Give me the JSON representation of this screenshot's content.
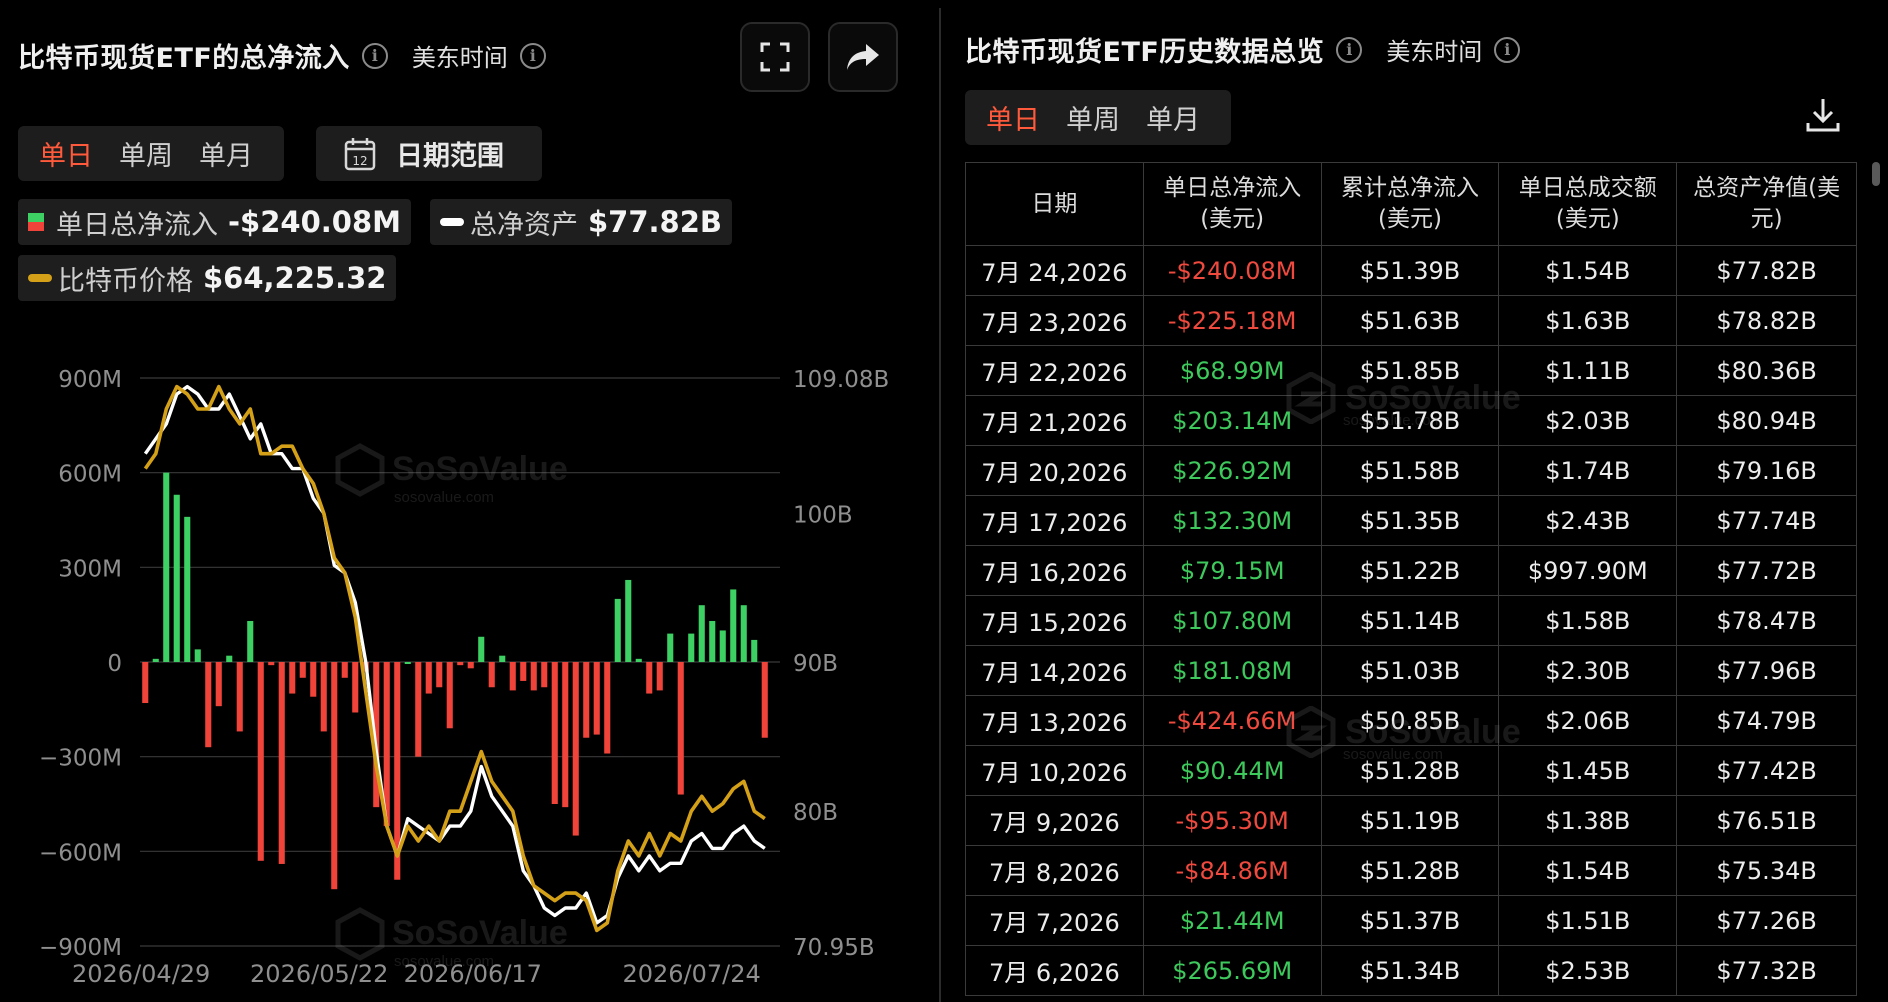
{
  "left": {
    "title": "比特币现货ETF的总净流入",
    "timezone": "美东时间",
    "tabs": [
      "单日",
      "单周",
      "单月"
    ],
    "active_tab": "单日",
    "date_range_label": "日期范围",
    "calendar_day": "12",
    "legend": {
      "net_inflow_name": "单日总净流入",
      "net_inflow_value": "-$240.08M",
      "net_assets_name": "总净资产",
      "net_assets_value": "$77.82B",
      "btc_price_name": "比特币价格",
      "btc_price_value": "$64,225.32"
    },
    "watermark": "SoSoValue",
    "watermark_sub": "sosovalue.com"
  },
  "chart_data": {
    "type": "bar",
    "title": "比特币现货ETF的总净流入",
    "x_ticks": [
      "2026/04/29",
      "2026/05/22",
      "2026/06/17",
      "2026/07/24"
    ],
    "y_left_ticks": [
      "900M",
      "600M",
      "300M",
      "0",
      "−300M",
      "−600M",
      "−900M"
    ],
    "y_left_range": [
      -900,
      900
    ],
    "y_right_ticks": [
      "109.08B",
      "100B",
      "90B",
      "80B",
      "70.95B"
    ],
    "y_right_range": [
      70.95,
      109.08
    ],
    "series": [
      {
        "name": "单日总净流入",
        "unit": "M USD",
        "type": "bar",
        "values": [
          -130,
          10,
          600,
          530,
          460,
          40,
          -270,
          -140,
          20,
          -220,
          130,
          -630,
          -10,
          -640,
          -100,
          -50,
          -110,
          -220,
          -720,
          -50,
          -160,
          -30,
          -460,
          -520,
          -690,
          0,
          -300,
          -100,
          -80,
          -210,
          -10,
          -20,
          80,
          -80,
          20,
          -90,
          -60,
          -90,
          -80,
          -450,
          -460,
          -550,
          -240,
          -230,
          -290,
          200,
          260,
          10,
          -100,
          -90,
          90,
          -420,
          90,
          180,
          130,
          100,
          230,
          180,
          70,
          -240
        ]
      },
      {
        "name": "总净资产",
        "unit": "B USD",
        "type": "line",
        "color": "#ffffff",
        "values": [
          104,
          105,
          106,
          108,
          108.5,
          108,
          107,
          107,
          108,
          106.5,
          105,
          106,
          104,
          104,
          103,
          103,
          101,
          100,
          96.5,
          96,
          94,
          90,
          84,
          79,
          77,
          79.5,
          79,
          78.5,
          78,
          79,
          79,
          80,
          83,
          81,
          80,
          79,
          76,
          75,
          73.5,
          73,
          73.5,
          73.5,
          74.5,
          72.5,
          73,
          75.5,
          77,
          76,
          77,
          76,
          76.5,
          76.5,
          78,
          78.5,
          77.5,
          77.5,
          78.5,
          79,
          78,
          77.5
        ]
      },
      {
        "name": "比特币价格",
        "unit": "relative",
        "type": "line",
        "color": "#d4a017",
        "values": [
          103,
          104,
          107,
          108.5,
          108,
          107,
          107,
          108.5,
          107,
          106,
          107,
          104,
          104,
          104.5,
          104.5,
          103,
          102,
          100,
          97,
          96,
          93,
          88,
          83,
          79,
          77,
          79,
          78,
          79,
          78,
          80,
          80,
          82,
          84,
          82,
          81,
          80,
          77,
          75,
          74.5,
          74,
          74.5,
          74.5,
          74,
          72,
          72.5,
          76,
          78,
          77,
          78.5,
          77,
          78.5,
          78,
          80,
          81,
          80,
          80.5,
          81.5,
          82,
          80,
          79.5
        ]
      }
    ]
  },
  "right": {
    "title": "比特币现货ETF历史数据总览",
    "timezone": "美东时间",
    "tabs": [
      "单日",
      "单周",
      "单月"
    ],
    "active_tab": "单日",
    "headers": [
      "日期",
      "单日总净流入(美元)",
      "累计总净流入(美元)",
      "单日总成交额(美元)",
      "总资产净值(美元)"
    ],
    "header_lines": [
      [
        "日期"
      ],
      [
        "单日总净流入",
        "(美元)"
      ],
      [
        "累计总净流入",
        "(美元)"
      ],
      [
        "单日总成交额",
        "(美元)"
      ],
      [
        "总资产净值(美",
        "元)"
      ]
    ],
    "rows": [
      [
        "7月 24,2026",
        "-$240.08M",
        "$51.39B",
        "$1.54B",
        "$77.82B"
      ],
      [
        "7月 23,2026",
        "-$225.18M",
        "$51.63B",
        "$1.63B",
        "$78.82B"
      ],
      [
        "7月 22,2026",
        "$68.99M",
        "$51.85B",
        "$1.11B",
        "$80.36B"
      ],
      [
        "7月 21,2026",
        "$203.14M",
        "$51.78B",
        "$2.03B",
        "$80.94B"
      ],
      [
        "7月 20,2026",
        "$226.92M",
        "$51.58B",
        "$1.74B",
        "$79.16B"
      ],
      [
        "7月 17,2026",
        "$132.30M",
        "$51.35B",
        "$2.43B",
        "$77.74B"
      ],
      [
        "7月 16,2026",
        "$79.15M",
        "$51.22B",
        "$997.90M",
        "$77.72B"
      ],
      [
        "7月 15,2026",
        "$107.80M",
        "$51.14B",
        "$1.58B",
        "$78.47B"
      ],
      [
        "7月 14,2026",
        "$181.08M",
        "$51.03B",
        "$2.30B",
        "$77.96B"
      ],
      [
        "7月 13,2026",
        "-$424.66M",
        "$50.85B",
        "$2.06B",
        "$74.79B"
      ],
      [
        "7月 10,2026",
        "$90.44M",
        "$51.28B",
        "$1.45B",
        "$77.42B"
      ],
      [
        "7月 9,2026",
        "-$95.30M",
        "$51.19B",
        "$1.38B",
        "$76.51B"
      ],
      [
        "7月 8,2026",
        "-$84.86M",
        "$51.28B",
        "$1.54B",
        "$75.34B"
      ],
      [
        "7月 7,2026",
        "$21.44M",
        "$51.37B",
        "$1.51B",
        "$77.26B"
      ],
      [
        "7月 6,2026",
        "$265.69M",
        "$51.34B",
        "$2.53B",
        "$77.32B"
      ]
    ]
  },
  "colors": {
    "accent": "#ff5a3c",
    "positive": "#3ec95c",
    "negative": "#f04a3f",
    "bar_positive": "#3dd062",
    "bar_negative": "#f0443a",
    "gold": "#d4a017"
  }
}
